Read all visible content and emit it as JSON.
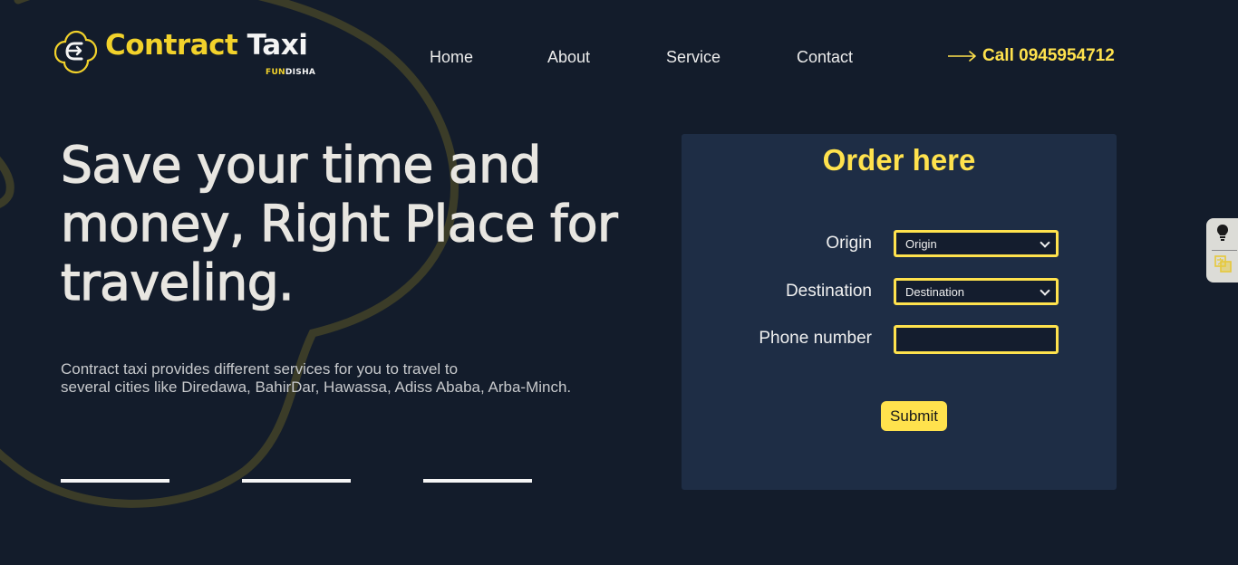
{
  "brand": {
    "name_part1": "Contract",
    "name_part2": "Taxi",
    "sub_part1": "FUN",
    "sub_part2": "DISHA"
  },
  "nav": {
    "items": [
      {
        "label": "Home"
      },
      {
        "label": "About"
      },
      {
        "label": "Service"
      },
      {
        "label": "Contact"
      }
    ],
    "call_label": "Call 0945954712"
  },
  "hero": {
    "title": "Save your time and money, Right Place for traveling.",
    "description_line1": "Contract taxi provides different services for you to travel to",
    "description_line2": "several cities like Diredawa, BahirDar, Hawassa, Adiss Ababa, Arba-Minch."
  },
  "order": {
    "title": "Order here",
    "origin_label": "Origin",
    "origin_value": "Origin",
    "destination_label": "Destination",
    "destination_value": "Destination",
    "phone_label": "Phone number",
    "phone_value": "",
    "submit_label": "Submit"
  },
  "colors": {
    "background": "#131c2b",
    "panel": "#1e2d45",
    "accent": "#ffe24d",
    "brand_yellow": "#f2d22b"
  },
  "icons": {
    "logo": "taxi-logo-icon",
    "call_arrow": "arrow-right-icon",
    "select_arrow": "chevron-down-icon",
    "widget_top": "lightbulb-icon",
    "widget_bottom": "translate-icon"
  }
}
